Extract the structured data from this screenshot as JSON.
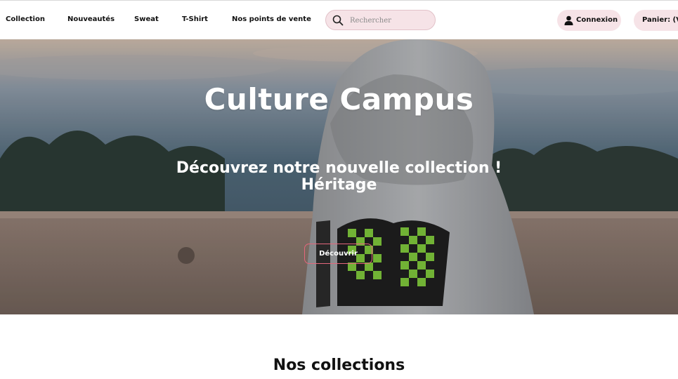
{
  "nav": {
    "items": [
      {
        "label": "Collection"
      },
      {
        "label": "Nouveautés"
      },
      {
        "label": "Sweat"
      },
      {
        "label": "T-Shirt"
      },
      {
        "label": "Nos points de vente"
      }
    ],
    "search": {
      "placeholder": "Rechercher",
      "icon": "search-icon"
    },
    "login": {
      "label": "Connexion",
      "icon": "user-icon"
    },
    "cart": {
      "label": "Panier: (Vide)"
    }
  },
  "hero": {
    "title": "Culture Campus",
    "subtitle_line1": "Découvrez notre nouvelle collection !",
    "subtitle_line2": "Héritage",
    "button_label": "Découvrir",
    "button_border_color": "#e4667c"
  },
  "collections": {
    "title": "Nos collections"
  },
  "colors": {
    "pill_bg": "#f6e3e7",
    "accent": "#e4667c"
  }
}
